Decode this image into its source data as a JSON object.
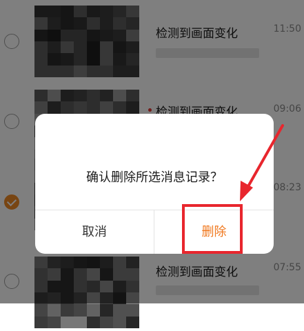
{
  "list": {
    "items": [
      {
        "title": "检测到画面变化",
        "time": "11:50",
        "checked": false,
        "unread": false
      },
      {
        "title": "检测到画面变化",
        "time": "09:06",
        "checked": false,
        "unread": true
      },
      {
        "title": "",
        "time": "08:23",
        "checked": true,
        "unread": false
      },
      {
        "title": "检测到画面变化",
        "time": "07:55",
        "checked": false,
        "unread": false
      }
    ]
  },
  "dialog": {
    "message": "确认删除所选消息记录？",
    "cancel_label": "取消",
    "delete_label": "删除"
  },
  "colors": {
    "accent": "#f0781e",
    "annotation": "#e8262d",
    "overlay": "rgba(0,0,0,0.5)"
  },
  "icons": {
    "radio": "radio-circle-icon",
    "checked": "checkmark-circle-icon",
    "unread": "red-dot-icon"
  }
}
